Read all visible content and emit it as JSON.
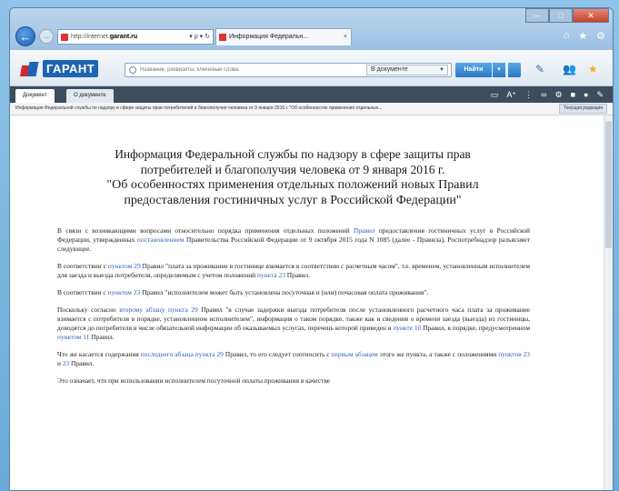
{
  "browser": {
    "address_prefix": "http://internet.",
    "address_host": "garant.ru",
    "address_controls": "▾ ρ ▾ ↻",
    "tab_title": "Информация Федеральн...",
    "tab_close": "×",
    "back_icon": "arrow-left-icon",
    "forward_icon": "arrow-right-icon",
    "tools": [
      "home-icon",
      "star-icon",
      "gear-icon"
    ]
  },
  "garant_header": {
    "logo_text": "ГАРАНТ",
    "search_placeholder": "Название, реквизиты, ключевые слова",
    "scope_select": "В документе",
    "find_button": "Найти"
  },
  "doc_toolbar": {
    "tabs": [
      "Документ",
      "О документе"
    ],
    "tools_text": "A⁺"
  },
  "breadcrumb": {
    "text": "Информация Федеральной службы по надзору в сфере защиты прав потребителей и благополучия человека от 9 января 2016 г. \"Об особенностях применения отдельных...",
    "date": "Текущая редакция"
  },
  "document": {
    "title_line1": "Информация Федеральной службы по надзору в сфере защиты прав",
    "title_line2": "потребителей и благополучия человека от 9 января 2016 г.",
    "title_line3": "\"Об особенностях применения отдельных положений новых Правил",
    "title_line4": "предоставления гостиничных услуг в Российской Федерации\"",
    "p1_a": "В связи с возникающими вопросами относительно порядка применения отдельных положений ",
    "p1_link1": "Правил",
    "p1_b": " предоставления гостиничных услуг в Российской Федерации, утвержденных ",
    "p1_link2": "постановлением",
    "p1_c": " Правительства Российской Федерации от 9 октября 2015 года N 1085 (далее - Правила), Роспотребнадзор разъясняет следующее.",
    "p2_a": "В соответствии с ",
    "p2_link1": "пунктом 29",
    "p2_b": " Правил \"плата за проживание в гостинице взимается в соответствии с расчетным часом\", т.е. временем, установленным исполнителем для заезда и выезда потребителя, определяемым с учетом положений ",
    "p2_link2": "пункта 23",
    "p2_c": " Правил.",
    "p3_a": "В соответствии с ",
    "p3_link1": "пунктом 23",
    "p3_b": " Правил \"исполнителем может быть установлена посуточная и (или) почасовая оплата проживания\".",
    "p4_a": "Поскольку согласно ",
    "p4_link1": "второму абзацу пункта 29",
    "p4_b": " Правил \"в случае задержки выезда потребителя после установленного расчетного часа плата за проживание взимается с потребителя в порядке, установленном исполнителем\", информация о таком порядке, также как и сведения о времени заезда (выезда) из гостиницы, доводятся до потребителя в числе обязательной информации об оказываемых услугах, перечень которой приведен в ",
    "p4_link2": "пункте 10",
    "p4_c": " Правил, в порядке, предусмотренном ",
    "p4_link3": "пунктом 11",
    "p4_d": " Правил.",
    "p5_a": "Что же касается содержания ",
    "p5_link1": "последнего абзаца пункта 29",
    "p5_b": " Правил, то его следует соотносить с ",
    "p5_link2": "первым абзацем",
    "p5_c": " этого же пункта, а также с положениями ",
    "p5_link3": "пунктов 23",
    "p5_d": " и ",
    "p5_link4": "23",
    "p5_e": " Правил.",
    "p6_a": "Это означает, что при использовании исполнителем посуточной оплаты проживания в качестве"
  }
}
